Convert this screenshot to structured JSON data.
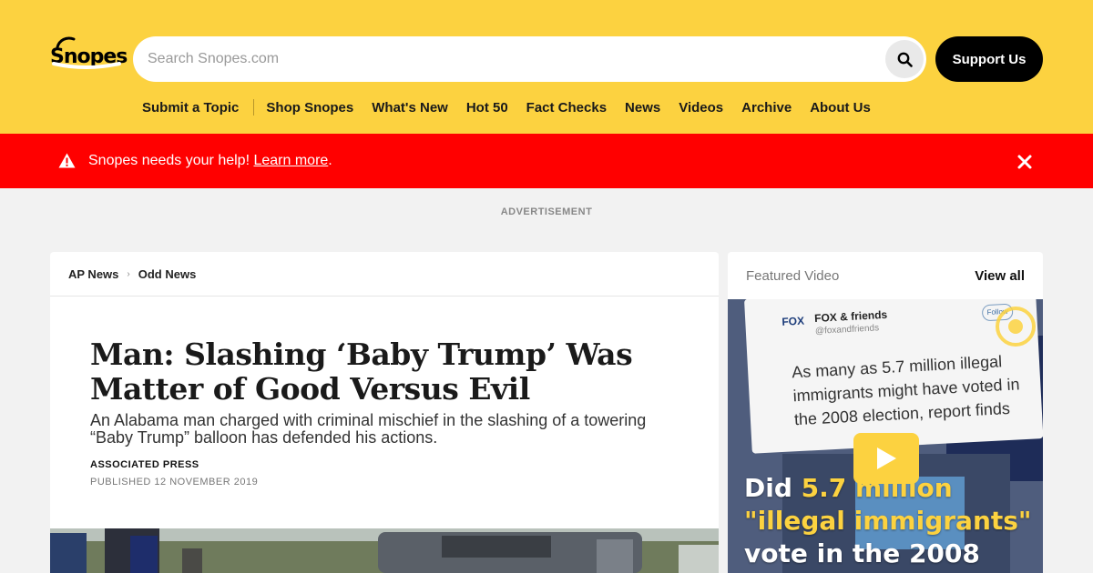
{
  "header": {
    "logo_text": "Snopes",
    "search": {
      "placeholder": "Search Snopes.com"
    },
    "support_label": "Support Us",
    "nav": {
      "submit": "Submit a Topic",
      "items": [
        "Shop Snopes",
        "What's New",
        "Hot 50",
        "Fact Checks",
        "News",
        "Videos",
        "Archive",
        "About Us"
      ]
    }
  },
  "alert": {
    "message": "Snopes needs your help!",
    "link": "Learn more",
    "trail": "."
  },
  "ad_label": "ADVERTISEMENT",
  "article": {
    "breadcrumb": [
      "AP News",
      "Odd News"
    ],
    "headline": "Man: Slashing ‘Baby Trump’ Was Matter of Good Versus Evil",
    "dek": "An Alabama man charged with criminal mischief in the slashing of a towering “Baby Trump” balloon has defended his actions.",
    "byline": "ASSOCIATED PRESS",
    "published": "PUBLISHED 12 NOVEMBER 2019"
  },
  "video": {
    "label": "Featured Video",
    "view_all": "View all",
    "tweet_brand": "FOX",
    "tweet_handle": "FOX & friends",
    "tweet_sub": "@foxandfriends",
    "tweet_follow": "Follow",
    "tweet_text": "As many as 5.7 million illegal immigrants might have voted in the 2008 election, report finds",
    "overlay": {
      "line1_a": "Did ",
      "line1_b": "5.7 million",
      "line2": "\"illegal immigrants\"",
      "line3": "vote in the 2008"
    }
  },
  "colors": {
    "brand_yellow": "#fcd240",
    "alert_red": "#ff0000"
  }
}
